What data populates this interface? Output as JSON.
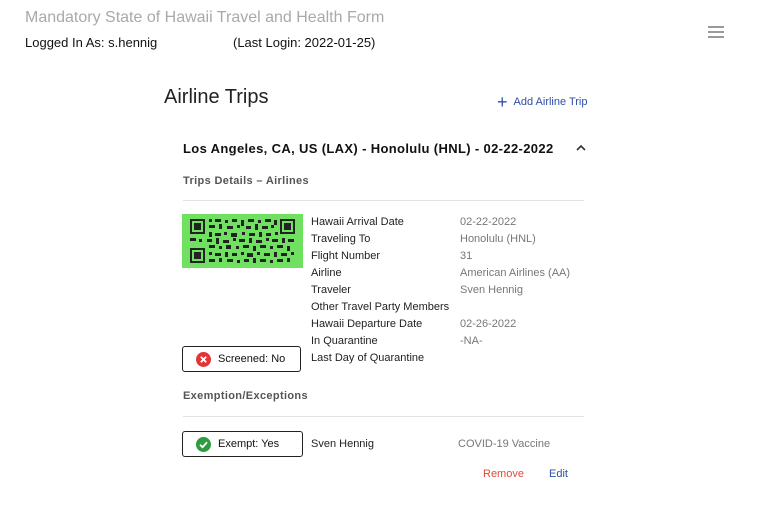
{
  "header": {
    "app_title": "Mandatory State of Hawaii Travel and Health Form",
    "logged_in": "Logged In As: s.hennig",
    "last_login": "(Last Login: 2022-01-25)",
    "menu_icon": "hamburger-menu-icon"
  },
  "main": {
    "section_title": "Airline Trips",
    "add_trip_label": "Add Airline Trip",
    "trip": {
      "heading": "Los Angeles, CA, US (LAX) - Honolulu (HNL) - 02-22-2022",
      "details_subhead": "Trips Details – Airlines",
      "qr_color": "#6fe060",
      "details": [
        {
          "label": "Hawaii Arrival Date",
          "value": "02-22-2022"
        },
        {
          "label": "Traveling To",
          "value": "Honolulu (HNL)"
        },
        {
          "label": "Flight Number",
          "value": "31"
        },
        {
          "label": "Airline",
          "value": "American Airlines (AA)"
        },
        {
          "label": "Traveler",
          "value": "Sven Hennig"
        },
        {
          "label": "Other Travel Party Members",
          "value": ""
        },
        {
          "label": "Hawaii Departure Date",
          "value": "02-26-2022"
        },
        {
          "label": "In Quarantine",
          "value": "-NA-"
        },
        {
          "label": "Last Day of Quarantine",
          "value": ""
        }
      ],
      "screened": {
        "label": "Screened: No",
        "icon": "x-circle-icon",
        "color": "#e0363a"
      },
      "exemption_subhead": "Exemption/Exceptions",
      "exempt": {
        "label": "Exempt: Yes",
        "icon": "check-circle-icon",
        "color": "#2e9b3f"
      },
      "exemption_row": {
        "name": "Sven Hennig",
        "reason": "COVID-19 Vaccine"
      },
      "remove_label": "Remove",
      "edit_label": "Edit"
    }
  }
}
